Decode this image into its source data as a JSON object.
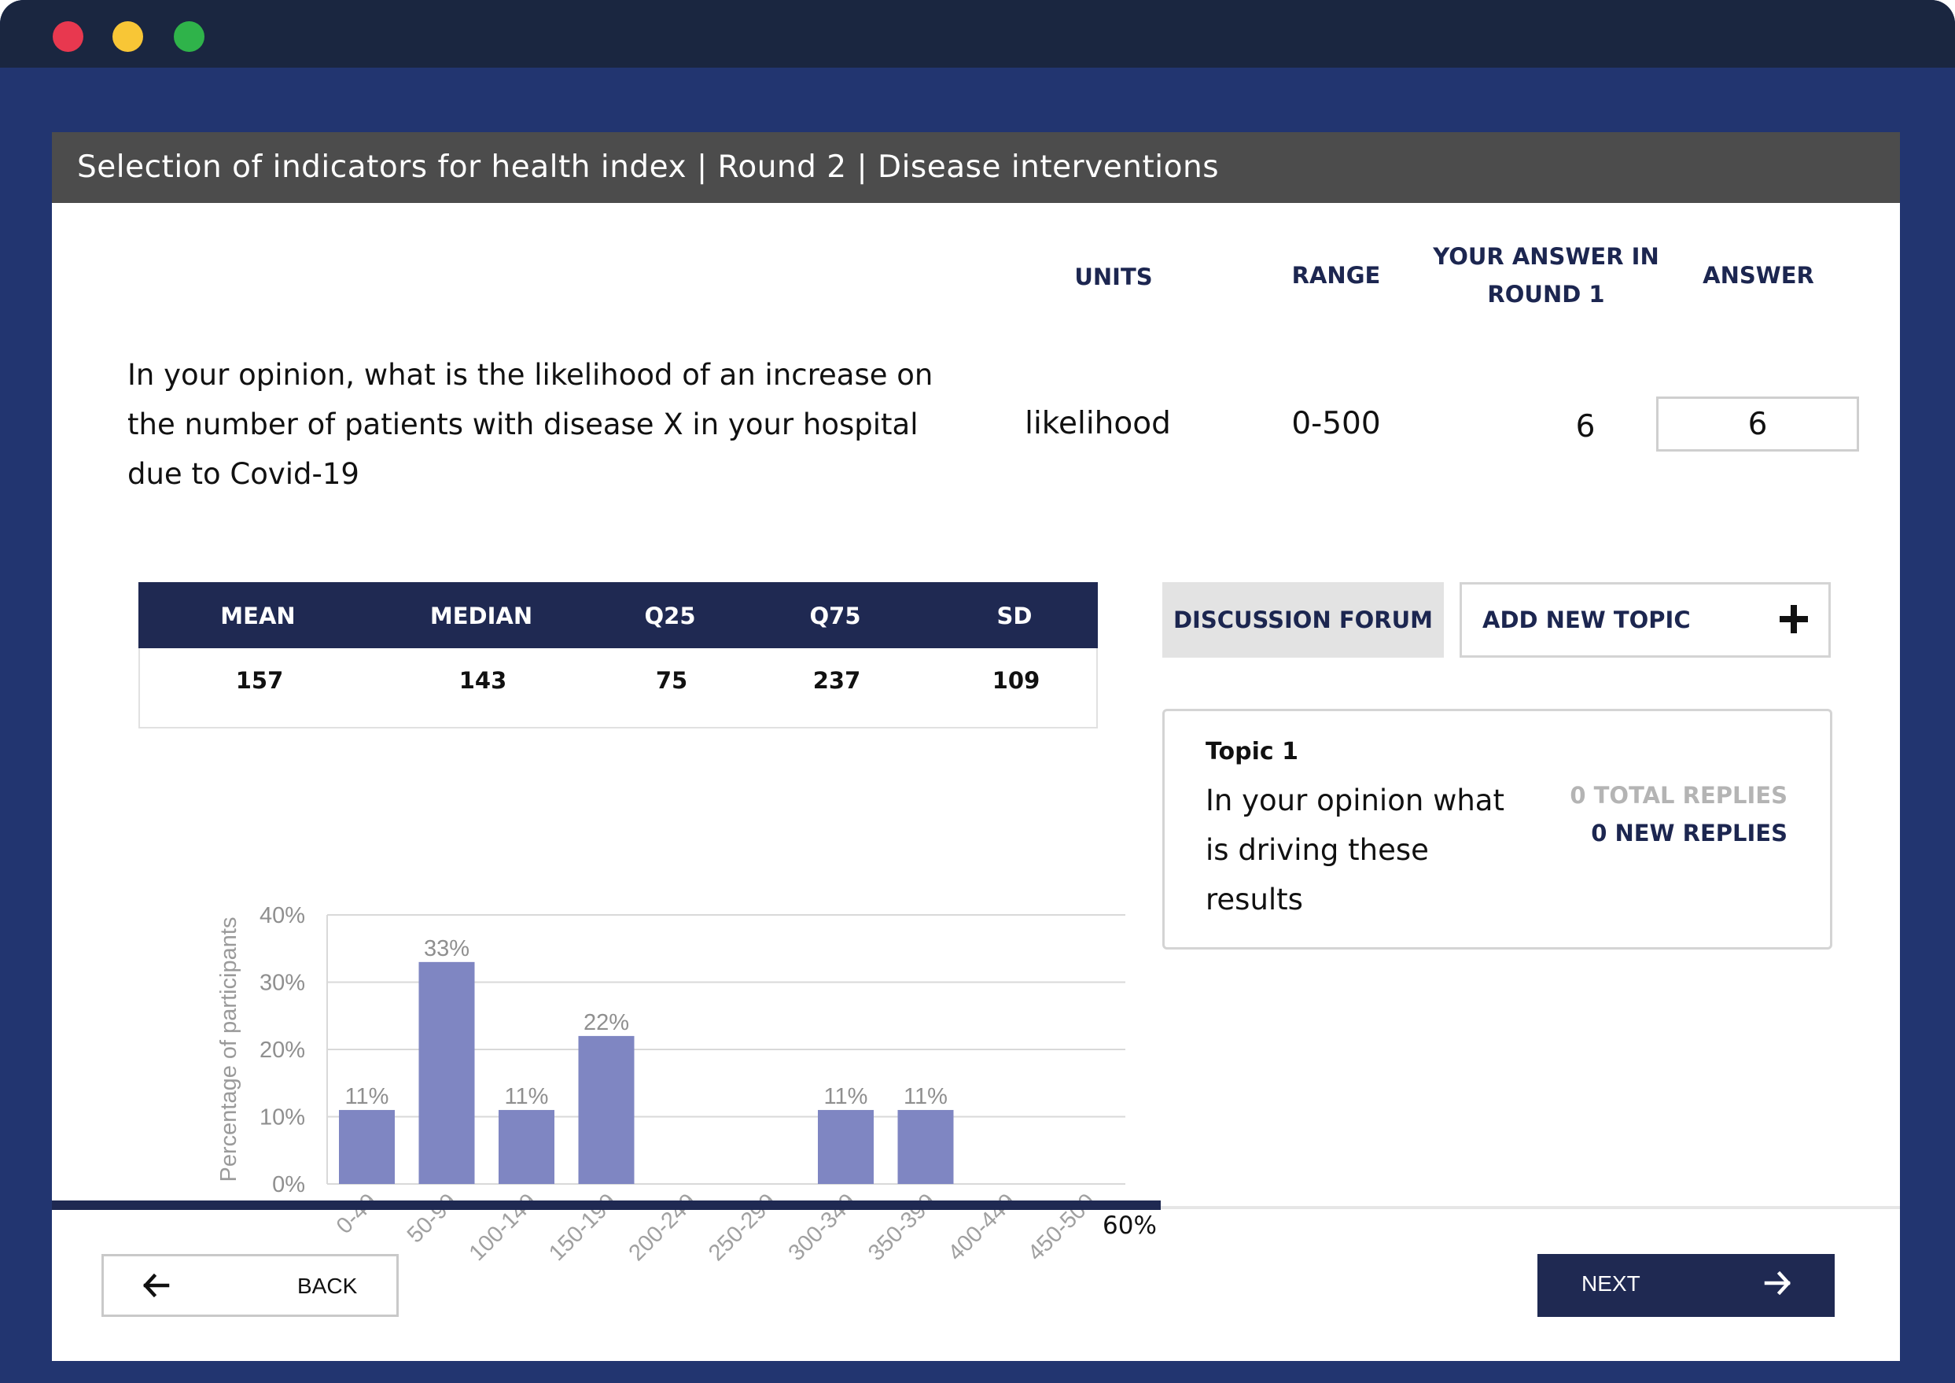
{
  "window": {
    "title": "Selection of indicators for health index | Round 2 | Disease interventions"
  },
  "question_table": {
    "headers": {
      "units": "UNITS",
      "range": "RANGE",
      "round1_line1": "YOUR ANSWER IN",
      "round1_line2": "ROUND 1",
      "answer": "ANSWER"
    },
    "question": "In your opinion, what is the likelihood of an increase on the number of patients with disease X in your hospital due to Covid-19",
    "units": "likelihood",
    "range": "0-500",
    "round1_answer": "6",
    "answer_value": "6"
  },
  "stats": {
    "headers": [
      "MEAN",
      "MEDIAN",
      "Q25",
      "Q75",
      "SD"
    ],
    "values": [
      "157",
      "143",
      "75",
      "237",
      "109"
    ]
  },
  "chart_data": {
    "type": "bar",
    "categories": [
      "0-49",
      "50-99",
      "100-149",
      "150-199",
      "200-249",
      "250-299",
      "300-349",
      "350-399",
      "400-449",
      "450-500"
    ],
    "values": [
      11,
      33,
      11,
      22,
      0,
      0,
      11,
      11,
      0,
      0
    ],
    "data_labels": [
      "11%",
      "33%",
      "11%",
      "22%",
      "",
      "",
      "11%",
      "11%",
      "",
      ""
    ],
    "ylabel": "Percentage of participants",
    "ylim": [
      0,
      40
    ],
    "yticks": [
      "0%",
      "10%",
      "20%",
      "30%",
      "40%"
    ],
    "grid": true,
    "bar_color": "#7f86c2"
  },
  "forum": {
    "tab_label": "DISCUSSION FORUM",
    "add_topic_label": "ADD NEW TOPIC",
    "topic": {
      "title": "Topic 1",
      "text": "In your opinion what is driving these results",
      "total_replies": "0 TOTAL REPLIES",
      "new_replies": "0 NEW REPLIES"
    }
  },
  "progress": {
    "percent": 60,
    "label": "60%"
  },
  "nav": {
    "back_label": "BACK",
    "next_label": "NEXT"
  },
  "icons": {
    "plus": "plus-icon",
    "back": "arrow-left-icon",
    "next": "arrow-right-icon"
  },
  "colors": {
    "navy": "#1f2952",
    "frame_blue": "#223570",
    "header_gray": "#4c4c4c"
  }
}
